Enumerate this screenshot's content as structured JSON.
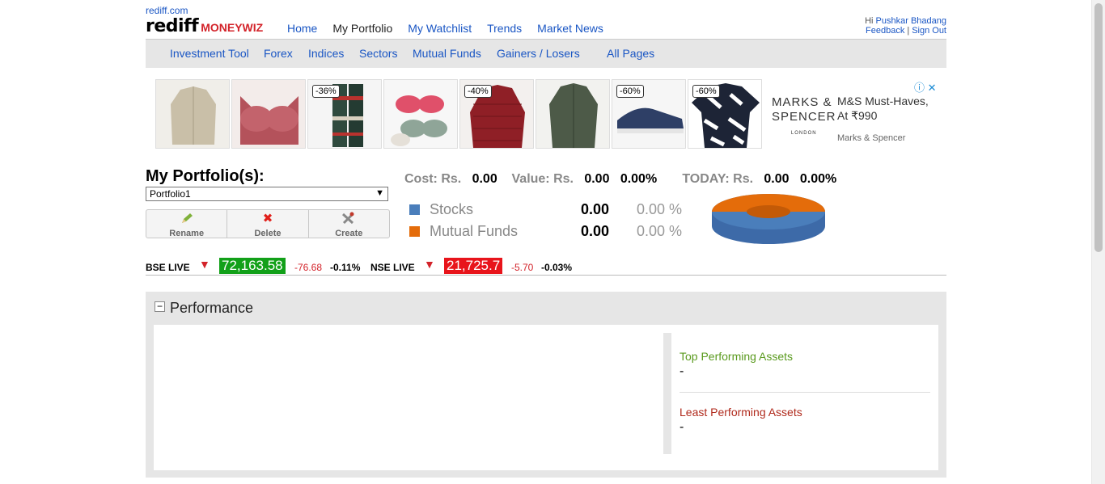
{
  "header": {
    "site_link": "rediff.com",
    "logo_main": "rediff",
    "logo_sub": "MONEYWIZ",
    "nav": [
      "Home",
      "My Portfolio",
      "My Watchlist",
      "Trends",
      "Market News"
    ],
    "user_greeting": "Hi",
    "user_name": "Pushkar Bhadang",
    "feedback": "Feedback",
    "separator": "|",
    "signout": "Sign Out"
  },
  "subnav": [
    "Investment Tool",
    "Forex",
    "Indices",
    "Sectors",
    "Mutual Funds",
    "Gainers / Losers",
    "All Pages"
  ],
  "ad": {
    "discounts": [
      "-36%",
      "-40%",
      "-60%",
      "-60%"
    ],
    "brand_line1": "MARKS &",
    "brand_line2": "SPENCER",
    "brand_city": "LONDON",
    "headline_1": "M&S Must-Haves,",
    "headline_2": "At ₹990",
    "sponsor": "Marks & Spencer",
    "info_icon": "ⓘ",
    "close_icon": "✕"
  },
  "portfolio": {
    "title": "My Portfolio(s):",
    "selected": "Portfolio1",
    "buttons": [
      "Rename",
      "Delete",
      "Create"
    ]
  },
  "summary": {
    "cost_label": "Cost: Rs.",
    "cost_value": "0.00",
    "value_label": "Value: Rs.",
    "value_value": "0.00",
    "value_pct": "0.00%",
    "today_label": "TODAY: Rs.",
    "today_value": "0.00",
    "today_pct": "0.00%"
  },
  "allocation": [
    {
      "name": "Stocks",
      "value": "0.00",
      "pct": "0.00 %",
      "color": "#4a7ebb"
    },
    {
      "name": "Mutual Funds",
      "value": "0.00",
      "pct": "0.00 %",
      "color": "#e46c0a"
    }
  ],
  "ticker": {
    "bse_label": "BSE LIVE",
    "bse_value": "72,163.58",
    "bse_change": "-76.68",
    "bse_pct": "-0.11%",
    "nse_label": "NSE LIVE",
    "nse_value": "21,725.7",
    "nse_change": "-5.70",
    "nse_pct": "-0.03%",
    "bse_color": "#12a019",
    "nse_color": "#e8141b"
  },
  "performance": {
    "title": "Performance",
    "top_label": "Top Performing Assets",
    "top_value": "-",
    "least_label": "Least Performing Assets",
    "least_value": "-"
  }
}
